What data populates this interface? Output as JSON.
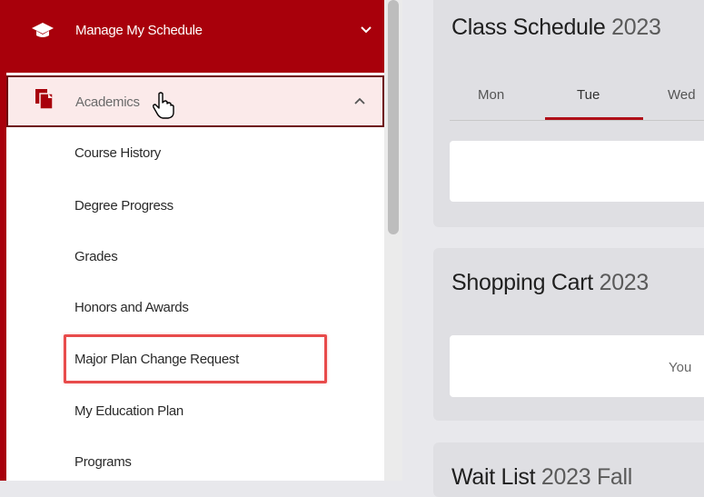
{
  "sidebar": {
    "header_label": "Manage My Schedule",
    "section_label": "Academics",
    "items": [
      "Course History",
      "Degree Progress",
      "Grades",
      "Honors and Awards",
      "Major Plan Change Request",
      "My Education Plan",
      "Programs"
    ]
  },
  "cards": {
    "class_schedule": {
      "title": "Class Schedule",
      "suffix": "2023"
    },
    "shopping_cart": {
      "title": "Shopping Cart",
      "suffix": "2023"
    },
    "wait_list": {
      "title": "Wait List",
      "suffix": "2023 Fall"
    }
  },
  "tabs": [
    "Mon",
    "Tue",
    "Wed"
  ],
  "shopping_cart_message": "You",
  "colors": {
    "brand_red": "#a8000b",
    "highlight": "#e84b4b"
  }
}
